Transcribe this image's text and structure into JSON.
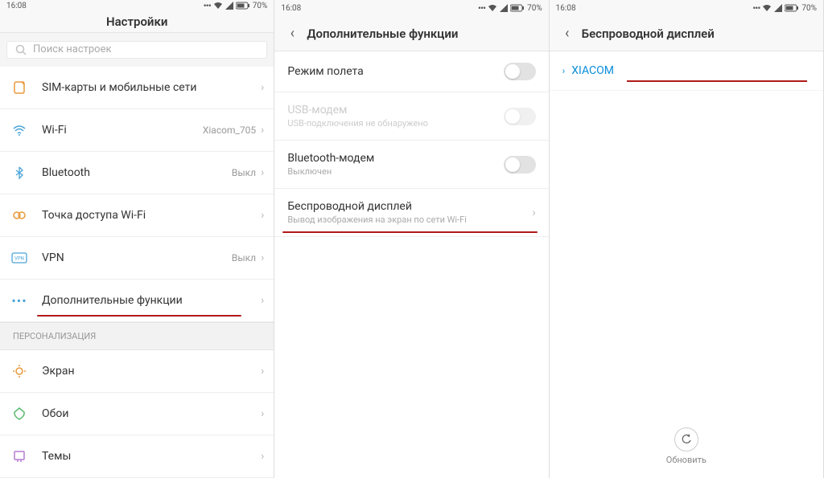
{
  "statusbar": {
    "time": "16:08",
    "battery": "70%"
  },
  "screen1": {
    "title": "Настройки",
    "searchPlaceholder": "Поиск настроек",
    "rows": {
      "sim": "SIM-карты и мобильные сети",
      "wifi": "Wi-Fi",
      "wifiValue": "Xiacom_705",
      "bluetooth": "Bluetooth",
      "bluetoothValue": "Выкл",
      "hotspot": "Точка доступа Wi-Fi",
      "vpn": "VPN",
      "vpnValue": "Выкл",
      "more": "Дополнительные функции"
    },
    "sectionPersonalization": "ПЕРСОНАЛИЗАЦИЯ",
    "display": "Экран",
    "wallpaper": "Обои",
    "themes": "Темы"
  },
  "screen2": {
    "title": "Дополнительные функции",
    "airplane": "Режим полета",
    "usb": "USB-модем",
    "usbSub": "USB-подключения не обнаружено",
    "bt": "Bluetooth-модем",
    "btSub": "Выключен",
    "wdisplay": "Беспроводной дисплей",
    "wdisplaySub": "Вывод изображения на экран по сети Wi-Fi"
  },
  "screen3": {
    "title": "Беспроводной дисплей",
    "device": "XIACOM",
    "refresh": "Обновить"
  }
}
